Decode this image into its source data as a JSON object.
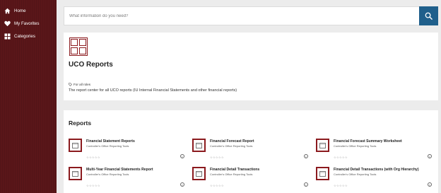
{
  "sidebar": {
    "items": [
      {
        "label": "Home",
        "icon": "home-icon"
      },
      {
        "label": "My Favorites",
        "icon": "heart-icon"
      },
      {
        "label": "Categories",
        "icon": "grid-icon"
      }
    ]
  },
  "search": {
    "placeholder": "What information do you need?",
    "button_icon": "search-icon"
  },
  "collection": {
    "title": "UCO Reports",
    "roles": "For all roles",
    "description": "The report center for all UCO reports (IU Internal Financial Statements and other financial reports)"
  },
  "reports": {
    "section_title": "Reports",
    "items": [
      {
        "name": "Financial Statement Reports",
        "owner": "Controller's Office Reporting Tools",
        "rating": "☆☆☆☆☆",
        "info": "i"
      },
      {
        "name": "Financial Forecast Report",
        "owner": "Controller's Office Reporting Tools",
        "rating": "☆☆☆☆☆",
        "info": "i"
      },
      {
        "name": "Financial Forecast Summary Worksheet",
        "owner": "Controller's Office Reporting Tools",
        "rating": "☆☆☆☆☆",
        "info": "i"
      },
      {
        "name": "Multi-Year Financial Statements Report",
        "owner": "Controller's Office Reporting Tools",
        "rating": "☆☆☆☆☆",
        "info": "i"
      },
      {
        "name": "Financial Detail Transactions",
        "owner": "Controller's Office Reporting Tools",
        "rating": "☆☆☆☆☆",
        "info": "i"
      },
      {
        "name": "Financial Detail Transactions (with Org Hierarchy)",
        "owner": "Controller's Office Reporting Tools",
        "rating": "☆☆☆☆☆",
        "info": "i"
      }
    ]
  },
  "colors": {
    "sidebar": "#5a1619",
    "accent": "#8b1a1e",
    "search_button": "#1f5f8b"
  }
}
